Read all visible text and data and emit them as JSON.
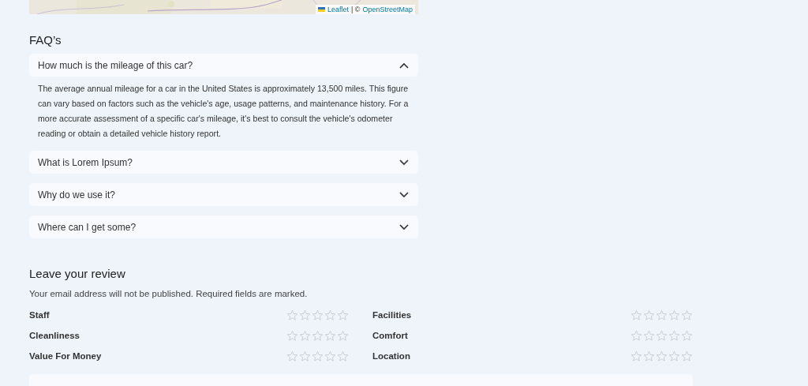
{
  "map": {
    "attribution": {
      "link": "Leaflet",
      "separator": "| ©",
      "source": "OpenStreetMap"
    }
  },
  "faq": {
    "title": "FAQ’s",
    "items": [
      {
        "question": "How much is the mileage of this car?",
        "expanded": true,
        "answer": "The average annual mileage for a car in the United States is approximately 13,500 miles. This figure can vary based on factors such as the vehicle's age, usage patterns, and maintenance history. For a more accurate assessment of a specific car's mileage, it's best to consult the vehicle's odometer reading or obtain a detailed vehicle history report."
      },
      {
        "question": "What is Lorem Ipsum?",
        "expanded": false
      },
      {
        "question": "Why do we use it?",
        "expanded": false
      },
      {
        "question": "Where can I get some?",
        "expanded": false
      }
    ]
  },
  "review": {
    "title": "Leave your review",
    "note": "Your email address will not be published. Required fields are marked.",
    "ratings": [
      {
        "label": "Staff",
        "stars": 0
      },
      {
        "label": "Facilities",
        "stars": 0
      },
      {
        "label": "Cleanliness",
        "stars": 0
      },
      {
        "label": "Comfort",
        "stars": 0
      },
      {
        "label": "Value For Money",
        "stars": 0
      },
      {
        "label": "Location",
        "stars": 0
      }
    ]
  }
}
